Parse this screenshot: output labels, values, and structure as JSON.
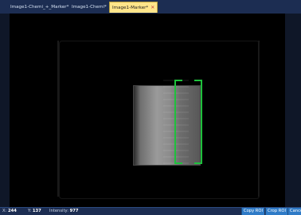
{
  "tabs": [
    {
      "label": "Image1-Chemi_+_Marker*",
      "active": false
    },
    {
      "label": "Image1-Chemi*",
      "active": false
    },
    {
      "label": "Image1-Marker*",
      "active": true
    }
  ],
  "status": {
    "x_label": "X:",
    "x_value": "244",
    "y_label": "Y:",
    "y_value": "137",
    "intensity_label": "Intensity:",
    "intensity_value": "977"
  },
  "buttons": {
    "copy_roi": "Copy ROI",
    "crop_roi": "Crop ROI",
    "cancel": "Cancel"
  },
  "colors": {
    "roi": "#1ec13c",
    "active_tab": "#ffe58a",
    "button": "#2f7bc7"
  }
}
